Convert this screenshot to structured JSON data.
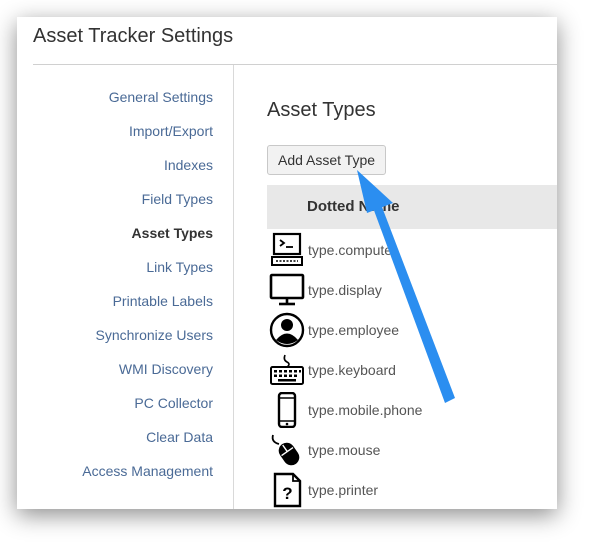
{
  "header": {
    "title": "Asset Tracker Settings"
  },
  "sidebar": {
    "items": [
      {
        "label": "General Settings"
      },
      {
        "label": "Import/Export"
      },
      {
        "label": "Indexes"
      },
      {
        "label": "Field Types"
      },
      {
        "label": "Asset Types",
        "active": true
      },
      {
        "label": "Link Types"
      },
      {
        "label": "Printable Labels"
      },
      {
        "label": "Synchronize Users"
      },
      {
        "label": "WMI Discovery"
      },
      {
        "label": "PC Collector"
      },
      {
        "label": "Clear Data"
      },
      {
        "label": "Access Management"
      }
    ]
  },
  "main": {
    "title": "Asset Types",
    "add_button": "Add Asset Type",
    "column_header": "Dotted Name",
    "rows": [
      {
        "name": "type.computer",
        "icon": "computer-icon"
      },
      {
        "name": "type.display",
        "icon": "display-icon"
      },
      {
        "name": "type.employee",
        "icon": "employee-icon"
      },
      {
        "name": "type.keyboard",
        "icon": "keyboard-icon"
      },
      {
        "name": "type.mobile.phone",
        "icon": "mobile-phone-icon"
      },
      {
        "name": "type.mouse",
        "icon": "mouse-icon"
      },
      {
        "name": "type.printer",
        "icon": "printer-icon"
      }
    ]
  },
  "annotation": {
    "arrow_color": "#2b8ef0"
  }
}
